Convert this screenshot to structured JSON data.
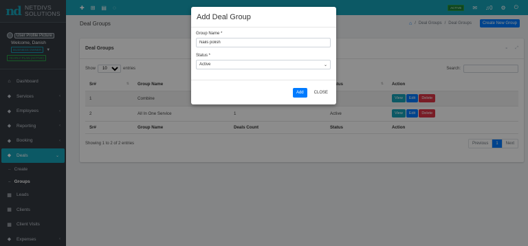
{
  "brand": {
    "logo": "nd",
    "line1": "NETDIVS",
    "line2": "SOLUTIONS"
  },
  "user": {
    "avatar_alt": "User Profile Picture",
    "welcome": "Welcome, Danish",
    "role_badge": "BUSINESS OWNER",
    "plan_badge": "YEARLY PLAN (ACTIVE)"
  },
  "sidebar": {
    "items": [
      {
        "label": "Dashboard",
        "icon": "home-icon"
      },
      {
        "label": "Services",
        "icon": "diamond-icon"
      },
      {
        "label": "Employees",
        "icon": "diamond-icon"
      },
      {
        "label": "Reporting",
        "icon": "diamond-icon"
      },
      {
        "label": "Booking",
        "icon": "diamond-icon"
      },
      {
        "label": "Deals",
        "icon": "diamond-icon"
      },
      {
        "label": "Leads",
        "icon": "grid-icon"
      },
      {
        "label": "Clients",
        "icon": "grid-icon"
      },
      {
        "label": "Client Visits",
        "icon": "grid-icon"
      },
      {
        "label": "Expenses",
        "icon": "diamond-icon"
      }
    ],
    "sub_items": [
      {
        "label": "Create"
      },
      {
        "label": "Groups"
      }
    ]
  },
  "topbar": {
    "status_pill": "ACTIVE",
    "notif_count": "0"
  },
  "header": {
    "title": "Deal Groups",
    "breadcrumb": [
      "Deal Groups",
      "Deal Groups"
    ],
    "new_button": "Create New Group"
  },
  "card": {
    "title": "Deal Groups",
    "show_label": "Show",
    "entries_value": "10",
    "entries_label": "entries",
    "search_label": "Search:",
    "columns": [
      "Sr#",
      "Group Name",
      "Deals Count",
      "Status",
      "Action"
    ],
    "rows": [
      {
        "sr": "1",
        "name": "Combine",
        "count": "",
        "status": ""
      },
      {
        "sr": "2",
        "name": "All In One Service",
        "count": "1",
        "status": "Active"
      }
    ],
    "actions": {
      "view": "View",
      "edit": "Edit",
      "delete": "Delete"
    },
    "info": "Showing 1 to 2 of 2 entries",
    "pager": {
      "prev": "Previous",
      "page": "1",
      "next": "Next"
    }
  },
  "modal": {
    "title": "Add Deal Group",
    "name_label": "Group Name *",
    "name_value": "Nails polish",
    "status_label": "Status *",
    "status_value": "Active",
    "add_button": "Add",
    "close_button": "CLOSE"
  },
  "colors": {
    "accent": "#17a2b8",
    "primary": "#007bff",
    "danger": "#dc3545",
    "sidebar": "#343a40"
  }
}
